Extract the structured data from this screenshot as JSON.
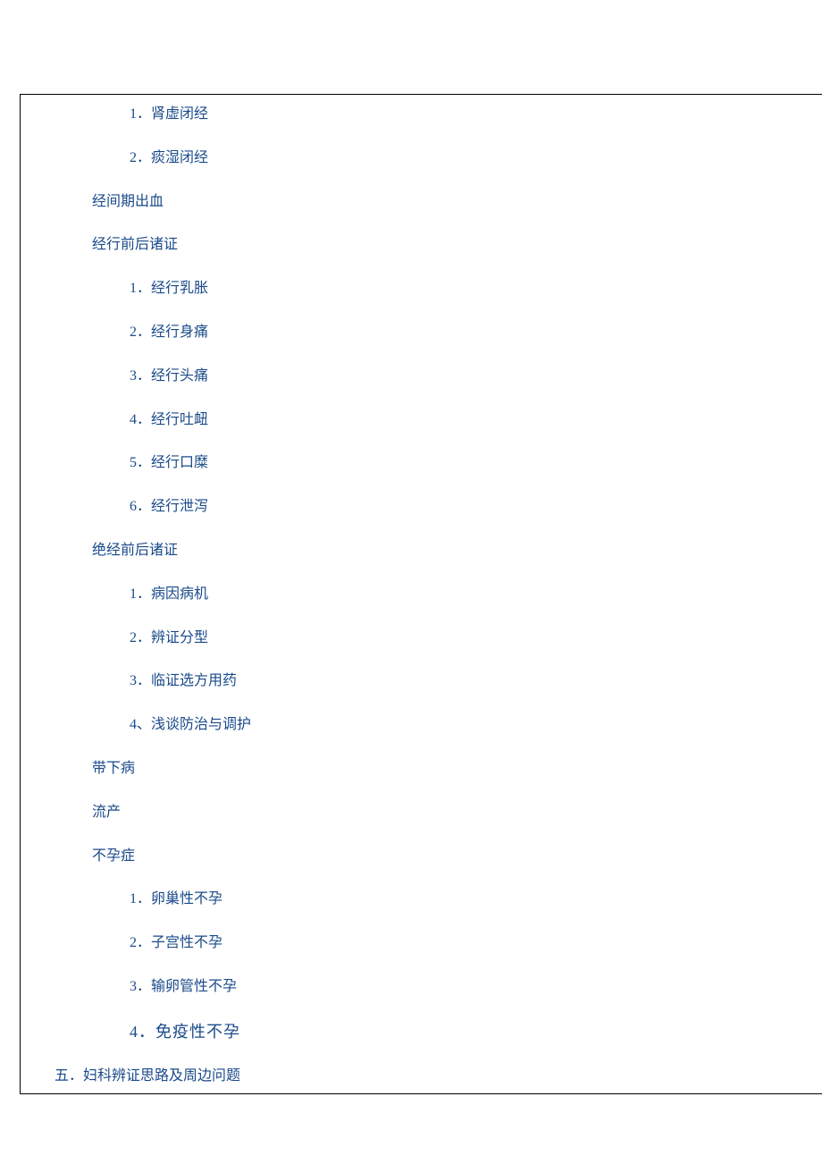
{
  "lines": [
    {
      "text": "1．肾虚闭经",
      "indent": 3,
      "special": false
    },
    {
      "text": "2．痰湿闭经",
      "indent": 3,
      "special": false
    },
    {
      "text": "经间期出血",
      "indent": 2,
      "special": false
    },
    {
      "text": "经行前后诸证",
      "indent": 2,
      "special": false
    },
    {
      "text": "1．经行乳胀",
      "indent": 3,
      "special": false
    },
    {
      "text": "2．经行身痛",
      "indent": 3,
      "special": false
    },
    {
      "text": "3．经行头痛",
      "indent": 3,
      "special": false
    },
    {
      "text": "4．经行吐衄",
      "indent": 3,
      "special": false
    },
    {
      "text": "5．经行口糜",
      "indent": 3,
      "special": false
    },
    {
      "text": "6．经行泄泻",
      "indent": 3,
      "special": false
    },
    {
      "text": "绝经前后诸证",
      "indent": 2,
      "special": false
    },
    {
      "text": "1．病因病机",
      "indent": 3,
      "special": false
    },
    {
      "text": "2．辨证分型",
      "indent": 3,
      "special": false
    },
    {
      "text": "3．临证选方用药",
      "indent": 3,
      "special": false
    },
    {
      "text": "4、浅谈防治与调护",
      "indent": 3,
      "special": false
    },
    {
      "text": "带下病",
      "indent": 2,
      "special": false
    },
    {
      "text": "流产",
      "indent": 2,
      "special": false
    },
    {
      "text": "不孕症",
      "indent": 2,
      "special": false
    },
    {
      "text": "1．卵巢性不孕",
      "indent": 3,
      "special": false
    },
    {
      "text": "2．子宫性不孕",
      "indent": 3,
      "special": false
    },
    {
      "text": "3．输卵管性不孕",
      "indent": 3,
      "special": false
    },
    {
      "text": "4．免疫性不孕",
      "indent": 3,
      "special": true
    },
    {
      "text": "五．妇科辨证思路及周边问题",
      "indent": 1,
      "special": false
    }
  ]
}
